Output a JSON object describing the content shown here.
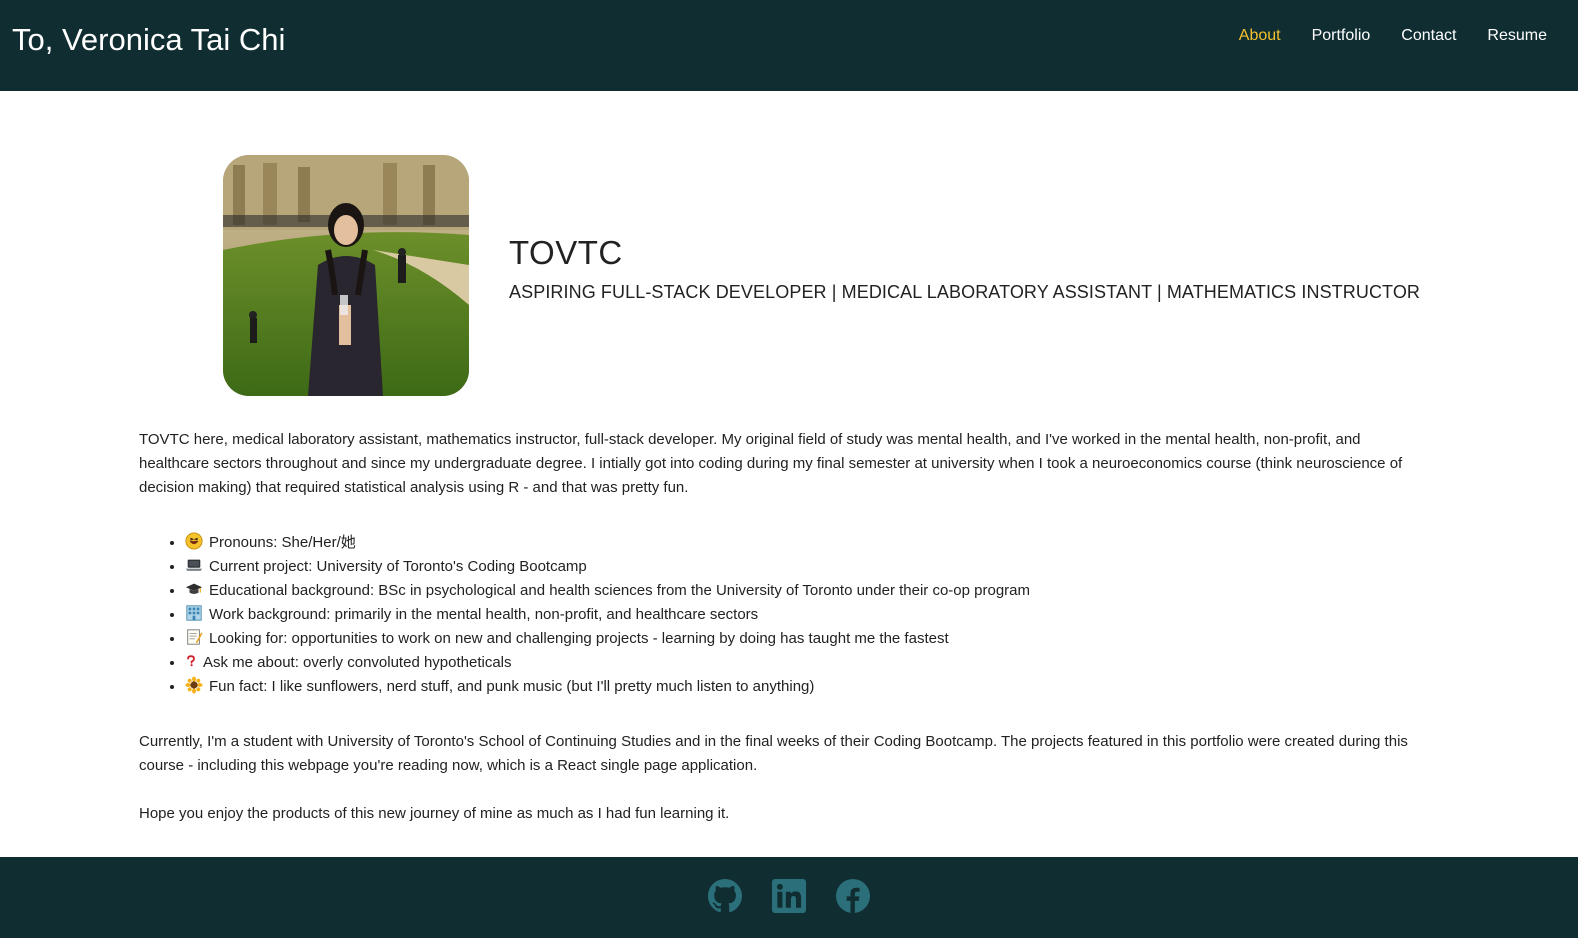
{
  "header": {
    "title": "To, Veronica Tai Chi",
    "nav": [
      {
        "label": "About",
        "active": true
      },
      {
        "label": "Portfolio",
        "active": false
      },
      {
        "label": "Contact",
        "active": false
      },
      {
        "label": "Resume",
        "active": false
      }
    ],
    "colors": {
      "background": "#102e32",
      "active": "#f2c12e",
      "text": "#ffffff"
    }
  },
  "hero": {
    "name": "TOVTC",
    "roles": "ASPIRING FULL-STACK DEVELOPER | MEDICAL LABORATORY ASSISTANT | MATHEMATICS INSTRUCTOR"
  },
  "about": {
    "intro": "TOVTC here, medical laboratory assistant, mathematics instructor, full-stack developer. My original field of study was mental health, and I've worked in the mental health, non-profit, and healthcare sectors throughout and since my undergraduate degree. I intially got into coding during my final semester at university when I took a neuroeconomics course (think neuroscience of decision making) that required statistical analysis using R - and that was pretty fun.",
    "facts": [
      {
        "icon": "grinning-face-icon",
        "text": "Pronouns: She/Her/她"
      },
      {
        "icon": "laptop-icon",
        "text": "Current project: University of Toronto's Coding Bootcamp"
      },
      {
        "icon": "graduation-cap-icon",
        "text": "Educational background: BSc in psychological and health sciences from the University of Toronto under their co-op program"
      },
      {
        "icon": "office-building-icon",
        "text": "Work background: primarily in the mental health, non-profit, and healthcare sectors"
      },
      {
        "icon": "memo-icon",
        "text": "Looking for: opportunities to work on new and challenging projects - learning by doing has taught me the fastest"
      },
      {
        "icon": "question-mark-icon",
        "text": "Ask me about: overly convoluted hypotheticals"
      },
      {
        "icon": "sunflower-icon",
        "text": "Fun fact: I like sunflowers, nerd stuff, and punk music (but I'll pretty much listen to anything)"
      }
    ],
    "current": "Currently, I'm a student with University of Toronto's School of Continuing Studies and in the final weeks of their Coding Bootcamp. The projects featured in this portfolio were created during this course - including this webpage you're reading now, which is a React single page application.",
    "closing": "Hope you enjoy the products of this new journey of mine as much as I had fun learning it."
  },
  "footer": {
    "icons": [
      "github-icon",
      "linkedin-icon",
      "facebook-icon"
    ],
    "icon_color": "#2b6f7a"
  }
}
